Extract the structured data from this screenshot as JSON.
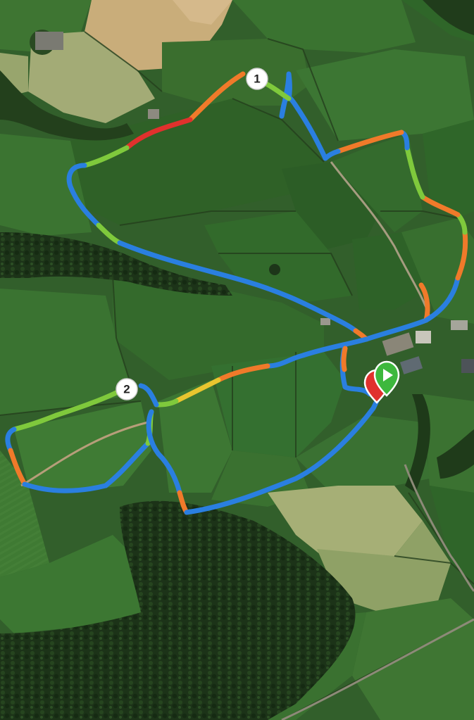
{
  "map": {
    "type": "satellite",
    "route_palette": {
      "blue": "#2a7fe0",
      "green": "#7fc93c",
      "yellow": "#e8c52f",
      "orange": "#f07a2a",
      "red": "#e0312d"
    },
    "lap_markers": [
      {
        "label": "1"
      },
      {
        "label": "2"
      }
    ],
    "start_marker": {
      "icon": "play-icon",
      "color": "#3db83d"
    },
    "finish_marker": {
      "icon": "flag-icon",
      "color": "#e0312d"
    }
  }
}
